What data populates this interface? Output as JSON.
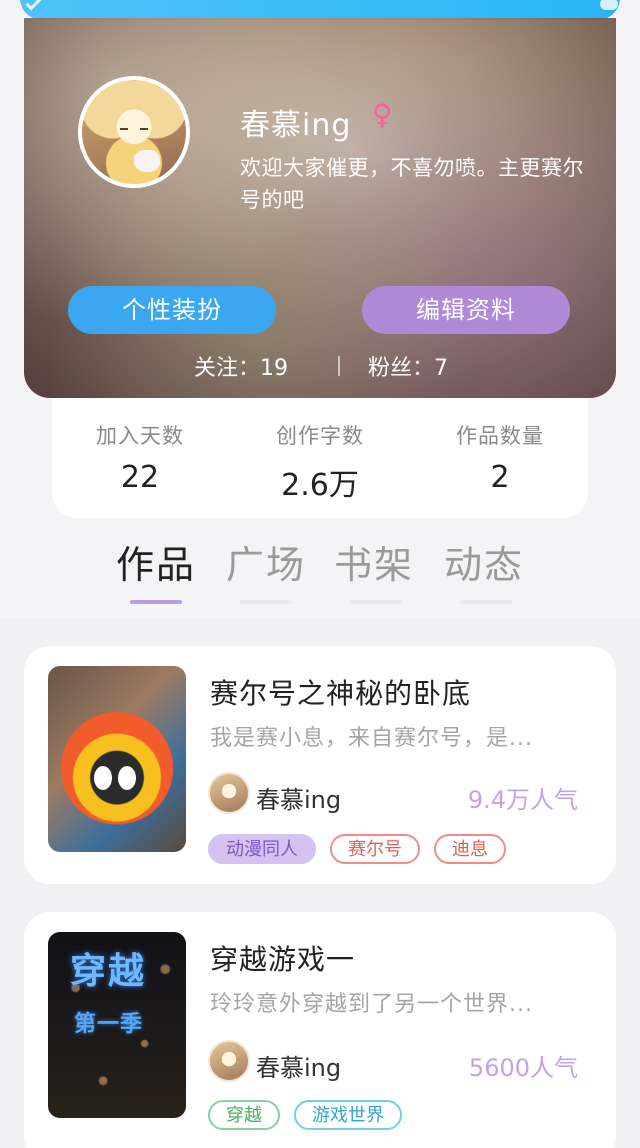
{
  "profile": {
    "username": "春慕ing",
    "gender_symbol": "♀",
    "bio": "欢迎大家催更，不喜勿喷。主更赛尔号的吧",
    "dress_button": "个性装扮",
    "edit_button": "编辑资料",
    "following": "关注：19",
    "fans": "粉丝：7"
  },
  "stats": [
    {
      "label": "加入天数",
      "value": "22"
    },
    {
      "label": "创作字数",
      "value": "2.6万"
    },
    {
      "label": "作品数量",
      "value": "2"
    }
  ],
  "tabs": [
    "作品",
    "广场",
    "书架",
    "动态"
  ],
  "works": [
    {
      "title": "赛尔号之神秘的卧底",
      "desc": "我是赛小息，来自赛尔号，是...",
      "author": "春慕ing",
      "popularity": "9.4万人气",
      "tags": [
        "动漫同人",
        "赛尔号",
        "迪息"
      ]
    },
    {
      "title": "穿越游戏一",
      "desc": "玲玲意外穿越到了另一个世界...",
      "author": "春慕ing",
      "popularity": "5600人气",
      "cover_title": "穿越",
      "cover_subtitle": "第一季",
      "tags": [
        "穿越",
        "游戏世界"
      ]
    }
  ],
  "colors": {
    "blue_button": "#3aa7f0",
    "purple_button": "#b08ad6",
    "popularity": "#c4a3e8",
    "active_tab_line": "#b79ee0"
  }
}
